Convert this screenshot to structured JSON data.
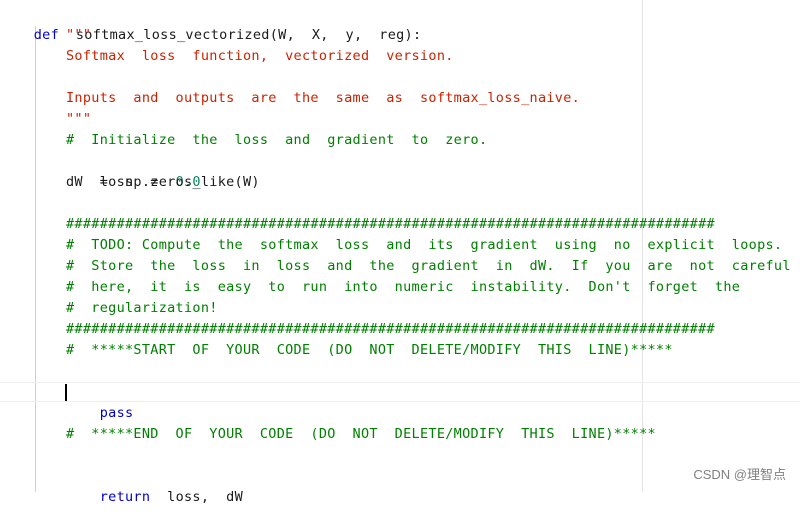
{
  "colors": {
    "keyword": "#0000cc",
    "string": "#cc2200",
    "comment": "#008000",
    "number": "#098658",
    "text": "#1a1a1a"
  },
  "code": {
    "l1": {
      "kw": "def",
      "rest": "softmax_loss_vectorized(W,  X,  y,  reg):"
    },
    "l2": "\"\"\"",
    "l3": "Softmax  loss  function,  vectorized  version.",
    "l5": "Inputs  and  outputs  are  the  same  as  softmax_loss_naive.",
    "l6": "\"\"\"",
    "l7": "#  Initialize  the  loss  and  gradient  to  zero.",
    "l8": {
      "a": "loss  =  ",
      "num": "0.0"
    },
    "l9": "dW  =  np.zeros_like(W)",
    "l11": "#############################################################################",
    "l12": "#  TODO: Compute  the  softmax  loss  and  its  gradient  using  no  explicit  loops.    #",
    "l13": "#  Store  the  loss  in  loss  and  the  gradient  in  dW.  If  you  are  not  careful",
    "l14": "#  here,  it  is  easy  to  run  into  numeric  instability.  Don't  forget  the",
    "l15": "#  regularization!",
    "l16": "#############################################################################",
    "l17": "#  *****START  OF  YOUR  CODE  (DO  NOT  DELETE/MODIFY  THIS  LINE)*****",
    "l19": {
      "kw": "pass"
    },
    "l21": "#  *****END  OF  YOUR  CODE  (DO  NOT  DELETE/MODIFY  THIS  LINE)*****",
    "l23": {
      "kw": "return",
      "rest": "  loss,  dW"
    }
  },
  "watermark": "CSDN @理智点"
}
